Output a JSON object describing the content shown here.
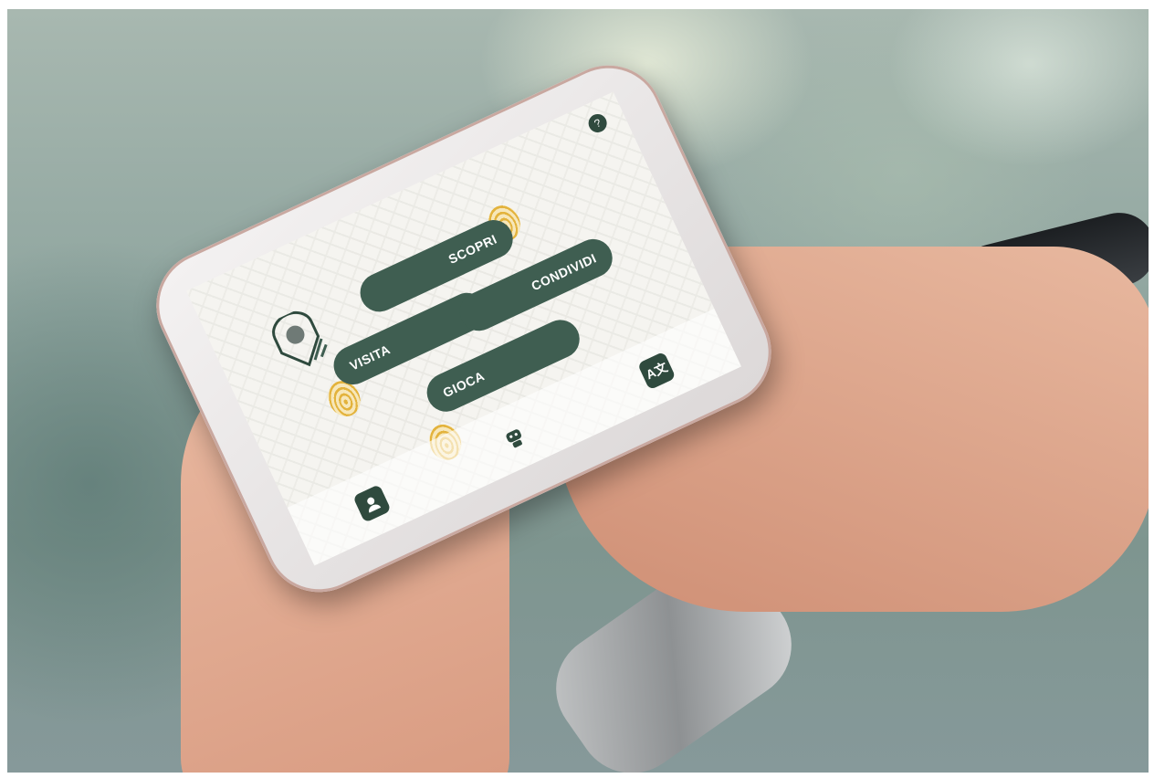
{
  "scene": {
    "description_colors": {
      "accent": "#3f5e51",
      "fingerprint": "#e3b33d",
      "screen_bg": "#f5f4f0"
    }
  },
  "app": {
    "help_icon": "speech-bubble-icon",
    "buttons": {
      "scopri": "SCOPRI",
      "visita": "VISITA",
      "condividi": "CONDIVIDI",
      "gioca": "GIOCA"
    },
    "nav": {
      "profile_icon": "user-profile-icon",
      "bot_icon": "robot-icon",
      "translate_icon": "translate-icon",
      "translate_glyph": "A文"
    }
  }
}
